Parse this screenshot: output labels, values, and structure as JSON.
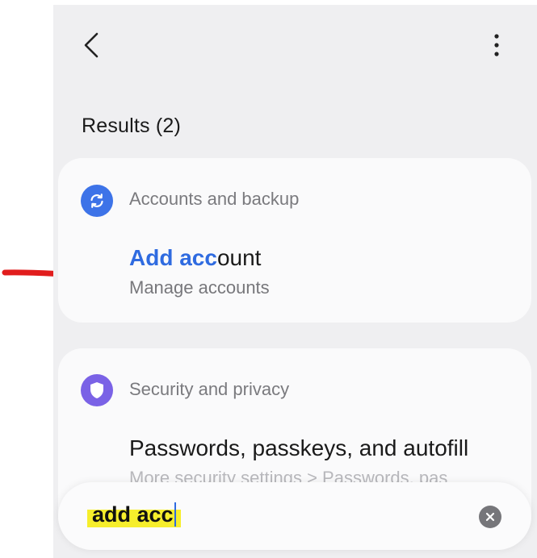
{
  "header": {
    "back_icon": "chevron-left-icon",
    "more_icon": "more-vertical-icon"
  },
  "results": {
    "title": "Results (2)",
    "groups": [
      {
        "category": "Accounts and backup",
        "category_icon": "sync-icon",
        "category_color": "#3d73e8",
        "item": {
          "title_match": "Add acc",
          "title_rest": "ount",
          "subtitle": "Manage accounts"
        }
      },
      {
        "category": "Security and privacy",
        "category_icon": "shield-icon",
        "category_color": "#7a62e6",
        "item": {
          "title": "Passwords, passkeys, and autofill",
          "subtitle": "More security settings > Passwords, pas"
        }
      }
    ]
  },
  "search": {
    "value": "add acc",
    "clear_icon": "clear-icon"
  },
  "annotation": {
    "arrow_icon": "red-arrow-icon",
    "arrow_color": "#e11d1d",
    "highlight_color": "#f6ee2c"
  },
  "colors": {
    "accent": "#2f6be0",
    "background": "#efeff1",
    "card": "#fafafb"
  }
}
